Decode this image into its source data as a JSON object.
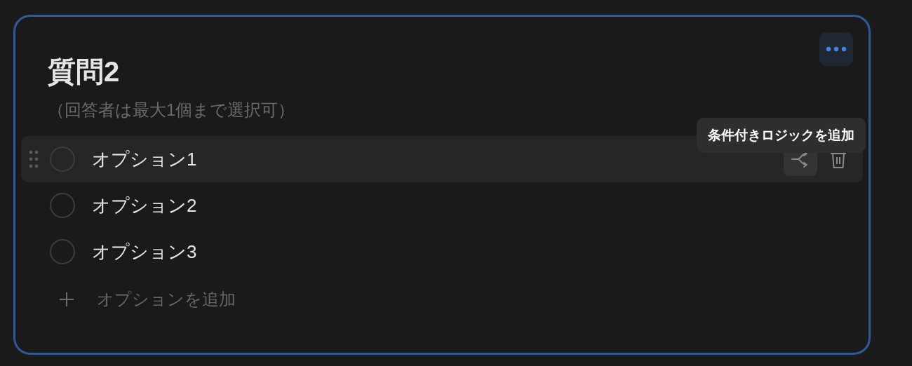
{
  "question": {
    "title": "質問2",
    "hint": "（回答者は最大1個まで選択可）",
    "selected": true
  },
  "options": [
    {
      "label": "オプション1",
      "hovered": true
    },
    {
      "label": "オプション2",
      "hovered": false
    },
    {
      "label": "オプション3",
      "hovered": false
    }
  ],
  "add_option": {
    "label": "オプションを追加"
  },
  "tooltip": {
    "text": "条件付きロジックを追加"
  }
}
